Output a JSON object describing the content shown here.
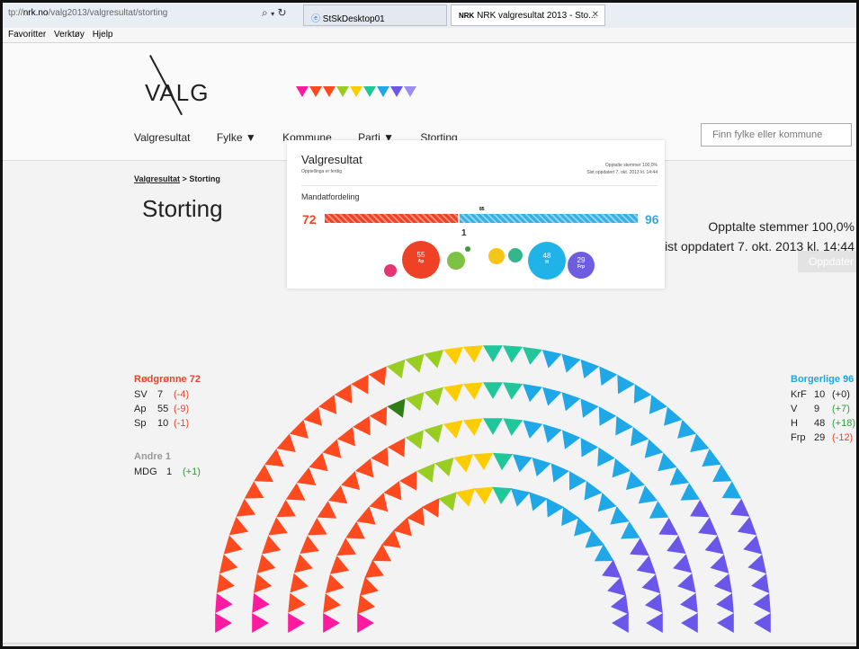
{
  "browser": {
    "url_prefix": "tp://",
    "url_domain": "nrk.no",
    "url_path": "/valg2013/valgresultat/storting",
    "tab1_label": "StSkDesktop01",
    "tab2_brand": "NRK",
    "tab2_label": "NRK valgresultat 2013 - Sto...",
    "menu": [
      "Favoritter",
      "Verktøy",
      "Hjelp"
    ]
  },
  "site": {
    "logo": "VALG",
    "nav": [
      {
        "label": "Valgresultat"
      },
      {
        "label": "Fylke ▼"
      },
      {
        "label": "Kommune"
      },
      {
        "label": "Parti ▼"
      },
      {
        "label": "Storting"
      }
    ],
    "search_placeholder": "Finn fylke eller kommune"
  },
  "panel": {
    "title": "Valgresultat",
    "subtitle": "Opptellinga er ferdig",
    "meta_line1": "Opptalte stemmer 100,0%",
    "meta_line2": "Sist oppdatert 7. okt. 2013 kl. 14:44",
    "mandat_label": "Mandatfordeling",
    "left_total": "72",
    "right_total": "96",
    "marker_top": "85",
    "marker_one": "1",
    "bubbles": [
      {
        "party": "SV",
        "seats": "7",
        "color": "#e6356f"
      },
      {
        "party": "Ap",
        "seats": "55",
        "color": "#ef4125"
      },
      {
        "party": "Sp",
        "seats": "10",
        "color": "#7dc242"
      },
      {
        "party": "MDG",
        "seats": "1",
        "color": "#3a9b42"
      },
      {
        "party": "KrF",
        "seats": "10",
        "color": "#f5c518"
      },
      {
        "party": "V",
        "seats": "9",
        "color": "#35b58b"
      },
      {
        "party": "H",
        "seats": "48",
        "color": "#1fb3e8"
      },
      {
        "party": "Frp",
        "seats": "29",
        "color": "#6f5de0"
      }
    ]
  },
  "page": {
    "breadcrumb_root": "Valgresultat",
    "breadcrumb_sep": ">",
    "breadcrumb_current": "Storting",
    "title": "Storting",
    "opptalte": "Opptalte stemmer 100,0%",
    "sist_oppdatert": "Sist oppdatert 7. okt. 2013 kl. 14:44",
    "update_button": "Oppdater"
  },
  "groups": {
    "rodgronne": {
      "title": "Rødgrønne 72",
      "color": "#e8432a",
      "rows": [
        {
          "party": "SV",
          "seats": "7",
          "change": "(-4)",
          "dir": "neg"
        },
        {
          "party": "Ap",
          "seats": "55",
          "change": "(-9)",
          "dir": "neg"
        },
        {
          "party": "Sp",
          "seats": "10",
          "change": "(-1)",
          "dir": "neg"
        }
      ]
    },
    "andre": {
      "title": "Andre 1",
      "color": "#999999",
      "rows": [
        {
          "party": "MDG",
          "seats": "1",
          "change": "(+1)",
          "dir": "pos"
        }
      ]
    },
    "borgerlige": {
      "title": "Borgerlige 96",
      "color": "#1fa6e0",
      "rows": [
        {
          "party": "KrF",
          "seats": "10",
          "change": "(+0)",
          "dir": "neu"
        },
        {
          "party": "V",
          "seats": "9",
          "change": "(+7)",
          "dir": "pos"
        },
        {
          "party": "H",
          "seats": "48",
          "change": "(+18)",
          "dir": "pos"
        },
        {
          "party": "Frp",
          "seats": "29",
          "change": "(-12)",
          "dir": "neg"
        }
      ]
    }
  },
  "parliament": {
    "seat_order": [
      {
        "party": "SV",
        "seats": 7,
        "color": "#ff1aa0"
      },
      {
        "party": "Ap",
        "seats": 55,
        "color": "#ff4a1f"
      },
      {
        "party": "MDG",
        "seats": 1,
        "color": "#2f7d16"
      },
      {
        "party": "Sp",
        "seats": 10,
        "color": "#9acd22"
      },
      {
        "party": "KrF",
        "seats": 10,
        "color": "#ffcc00"
      },
      {
        "party": "V",
        "seats": 9,
        "color": "#1fc79b"
      },
      {
        "party": "H",
        "seats": 48,
        "color": "#1ea8e8"
      },
      {
        "party": "Frp",
        "seats": 29,
        "color": "#6a56e8"
      }
    ],
    "total_seats": 169
  }
}
